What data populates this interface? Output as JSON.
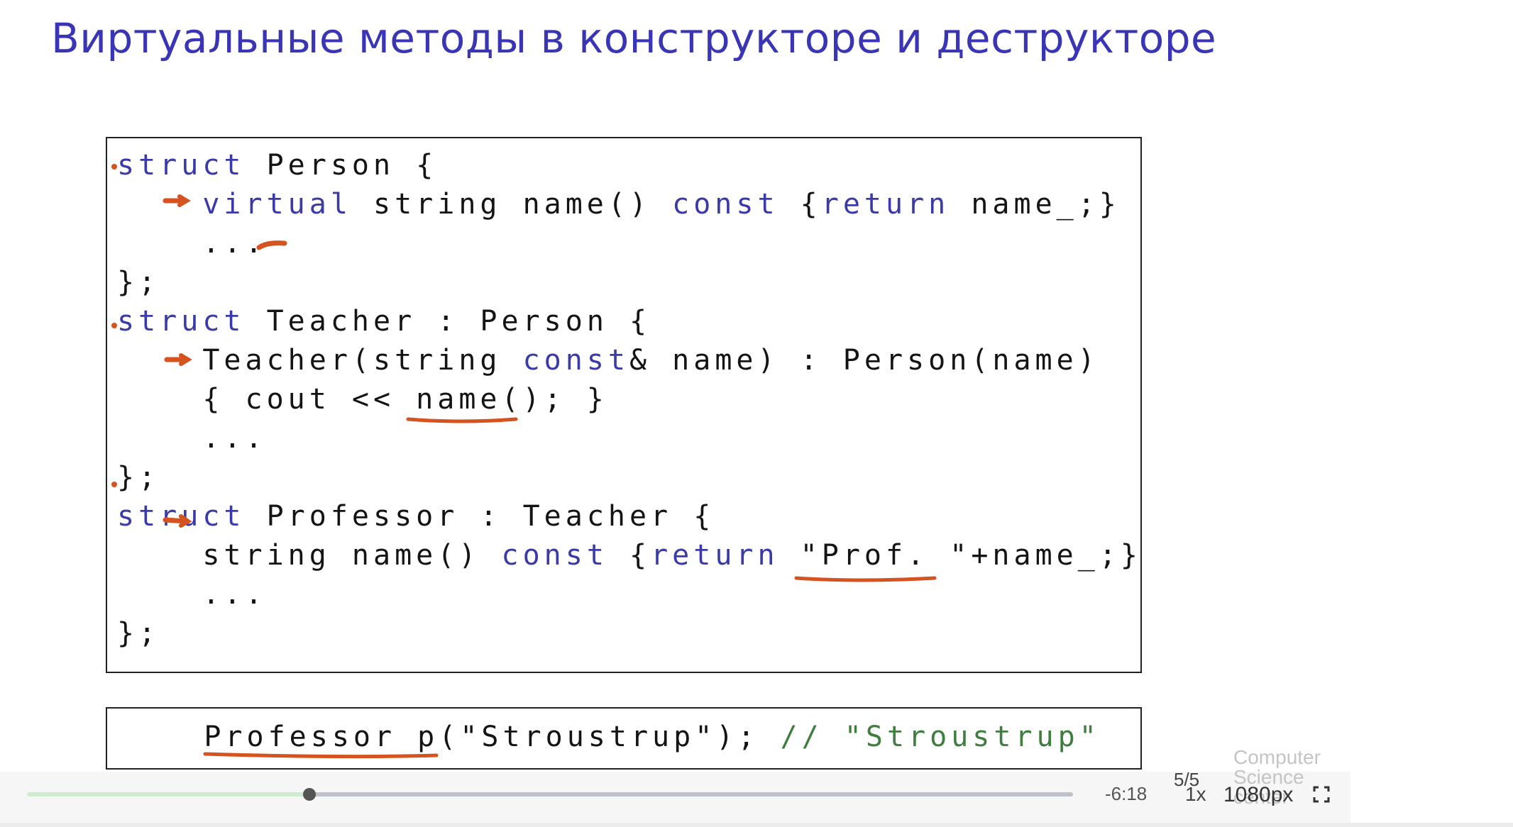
{
  "slide": {
    "title": "Виртуальные методы в конструкторе и деструкторе",
    "code_lines": [
      {
        "parts": [
          {
            "t": "struct",
            "k": "kw"
          },
          {
            "t": " Person {"
          }
        ]
      },
      {
        "parts": [
          {
            "t": "    "
          },
          {
            "t": "virtual",
            "k": "kw"
          },
          {
            "t": " string name() "
          },
          {
            "t": "const",
            "k": "kw"
          },
          {
            "t": " {"
          },
          {
            "t": "return",
            "k": "kw"
          },
          {
            "t": " name_;}"
          }
        ]
      },
      {
        "parts": [
          {
            "t": "    ..."
          }
        ]
      },
      {
        "parts": [
          {
            "t": "};"
          }
        ]
      },
      {
        "parts": [
          {
            "t": "struct",
            "k": "kw"
          },
          {
            "t": " Teacher : Person {"
          }
        ]
      },
      {
        "parts": [
          {
            "t": "    Teacher(string "
          },
          {
            "t": "const",
            "k": "kw"
          },
          {
            "t": "& name) : Person(name)"
          }
        ]
      },
      {
        "parts": [
          {
            "t": "    { cout << name(); }"
          }
        ]
      },
      {
        "parts": [
          {
            "t": "    ..."
          }
        ]
      },
      {
        "parts": [
          {
            "t": "};"
          }
        ]
      },
      {
        "parts": [
          {
            "t": "struct",
            "k": "kw"
          },
          {
            "t": " Professor : Teacher {"
          }
        ]
      },
      {
        "parts": [
          {
            "t": "    string name() "
          },
          {
            "t": "const",
            "k": "kw"
          },
          {
            "t": " {"
          },
          {
            "t": "return",
            "k": "kw"
          },
          {
            "t": " \"Prof. \"+name_;}"
          }
        ]
      },
      {
        "parts": [
          {
            "t": "    ..."
          }
        ]
      },
      {
        "parts": [
          {
            "t": "};"
          }
        ]
      }
    ],
    "example_parts": [
      {
        "t": "    Professor p(\"Stroustrup\"); "
      },
      {
        "t": "// \"Stroustrup\"",
        "k": "cm"
      }
    ]
  },
  "player": {
    "progress": 0.27,
    "time_remaining": "-6:18",
    "slide_counter": "5/5",
    "speed": "1x",
    "quality": "1080px",
    "brand_lines": [
      "Computer",
      "Science",
      "center"
    ]
  },
  "colors": {
    "title": "#3a35b5",
    "keyword": "#3a3aa8",
    "comment": "#3f7e3f",
    "annotation": "#d4531f"
  }
}
